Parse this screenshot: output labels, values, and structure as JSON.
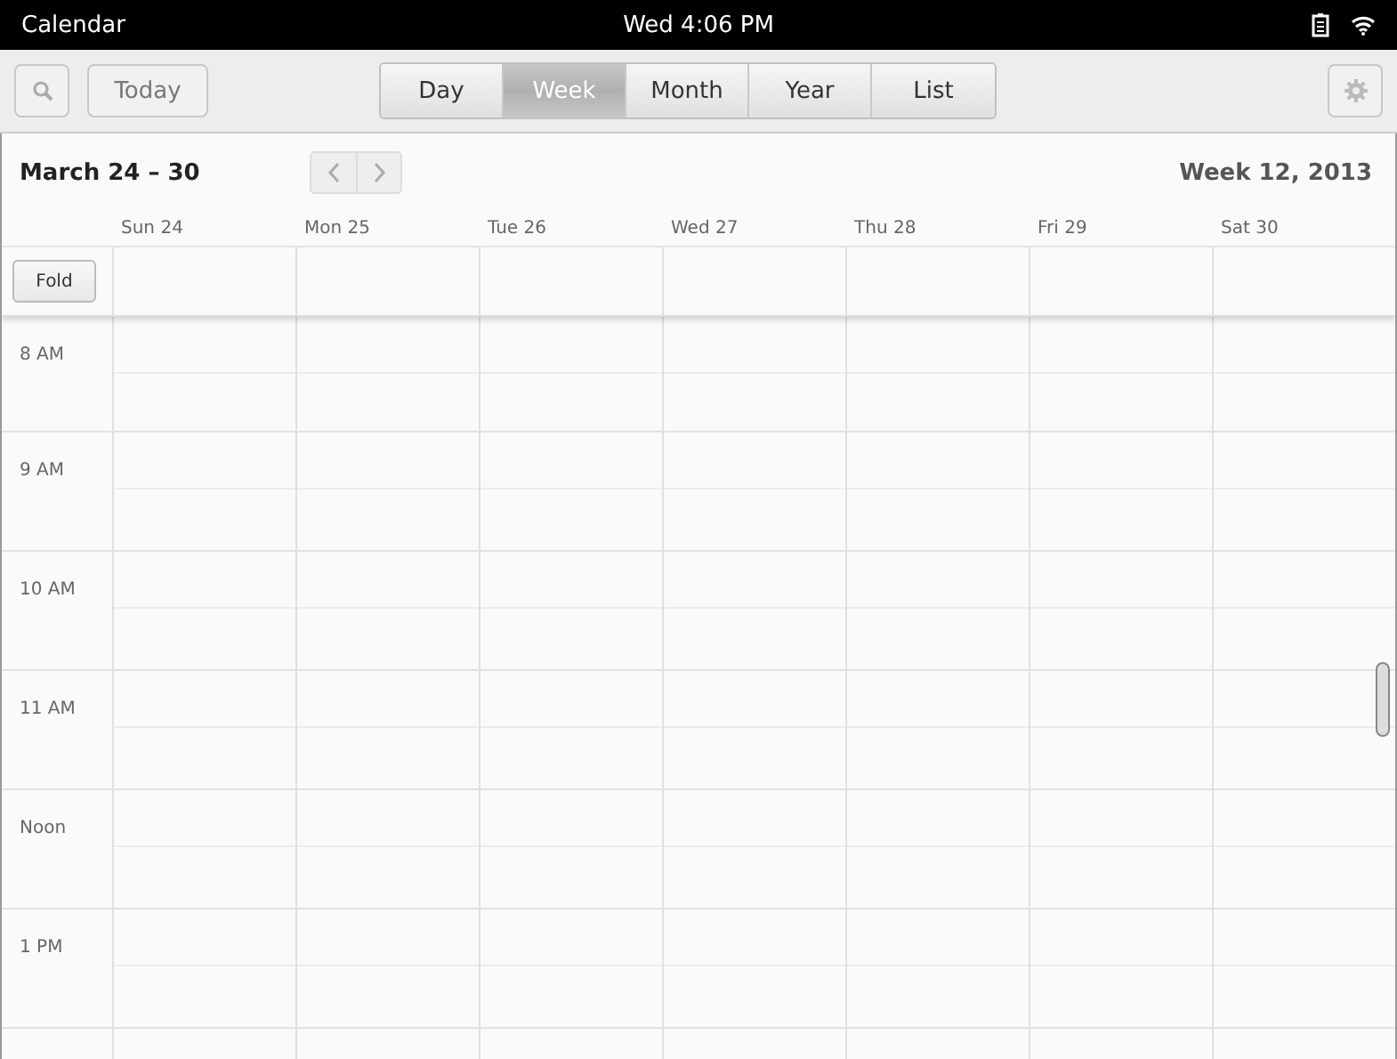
{
  "status_bar": {
    "app_name": "Calendar",
    "clock": "Wed 4:06 PM"
  },
  "toolbar": {
    "today_button": "Today",
    "views": [
      {
        "label": "Day",
        "selected": false
      },
      {
        "label": "Week",
        "selected": true
      },
      {
        "label": "Month",
        "selected": false
      },
      {
        "label": "Year",
        "selected": false
      },
      {
        "label": "List",
        "selected": false
      }
    ]
  },
  "header": {
    "range": "March 24 – 30",
    "week": "Week 12, 2013"
  },
  "days": [
    "Sun 24",
    "Mon 25",
    "Tue 26",
    "Wed 27",
    "Thu 28",
    "Fri 29",
    "Sat 30"
  ],
  "fold_button": "Fold",
  "hours": [
    "8 AM",
    "9 AM",
    "10 AM",
    "11 AM",
    "Noon",
    "1 PM"
  ]
}
